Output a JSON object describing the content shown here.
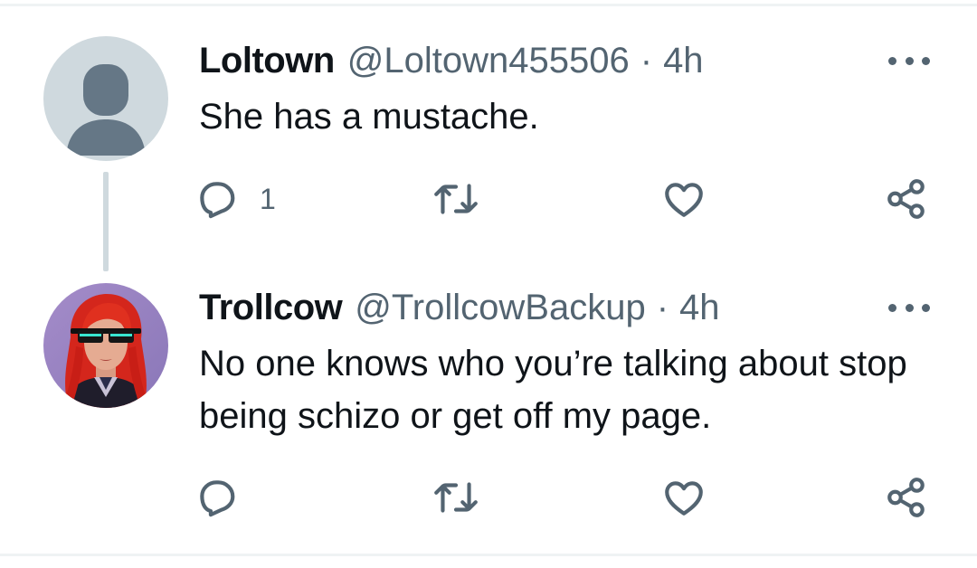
{
  "thread": [
    {
      "display_name": "Loltown",
      "handle": "@Loltown455506",
      "separator": "·",
      "time": "4h",
      "text": "She has a mustache.",
      "reply_count": "1",
      "avatar": "default-avatar-icon"
    },
    {
      "display_name": "Trollcow",
      "handle": "@TrollcowBackup",
      "separator": "·",
      "time": "4h",
      "text": "No one knows who you’re talking about stop being schizo or get off my page.",
      "reply_count": "",
      "avatar": "red-haired-sunglasses-portrait"
    }
  ],
  "icons": {
    "reply": "reply-icon",
    "retweet": "retweet-icon",
    "like": "heart-icon",
    "share": "share-icon",
    "more": "more-options-icon"
  },
  "colors": {
    "text": "#0f1419",
    "secondary": "#536471",
    "thread_line": "#cfd9de",
    "default_avatar_bg": "#cfd9de",
    "default_avatar_fg": "#657786"
  }
}
